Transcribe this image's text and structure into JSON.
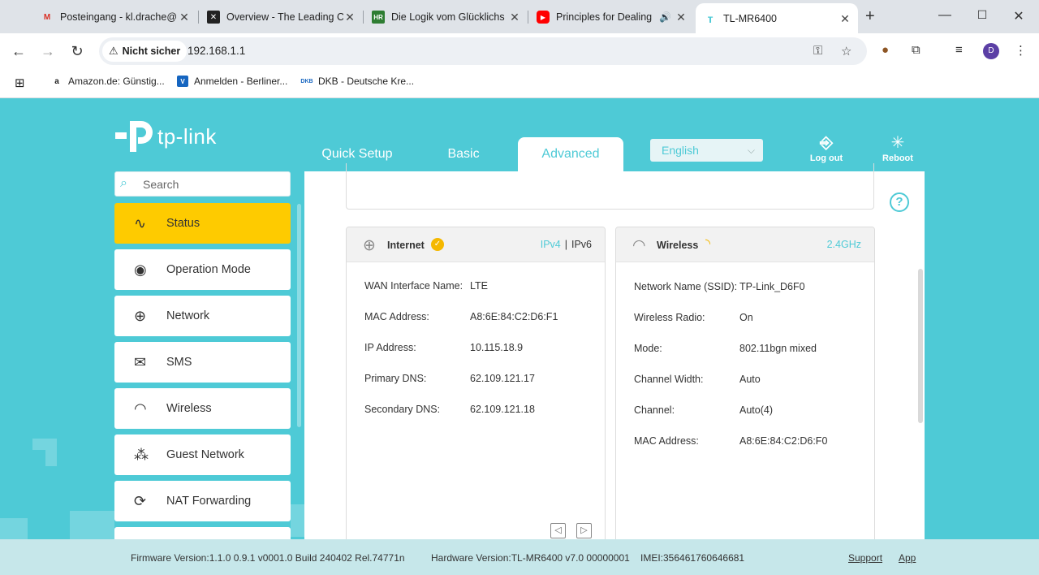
{
  "browser": {
    "tabs": [
      {
        "title": "Posteingang - kl.drache@",
        "favicon": "gmail-icon"
      },
      {
        "title": "Overview - The Leading C",
        "favicon": "app-icon"
      },
      {
        "title": "Die Logik vom Glücklichs",
        "favicon": "hr-icon"
      },
      {
        "title": "Principles for Dealing",
        "favicon": "youtube-icon"
      },
      {
        "title": "TL-MR6400",
        "favicon": "tplink-icon",
        "active": true
      }
    ],
    "security_label": "Nicht sicher",
    "url": "192.168.1.1",
    "profile_initial": "D",
    "bookmarks": [
      {
        "label": "Amazon.de: Günstig...",
        "icon": "amazon-icon"
      },
      {
        "label": "Anmelden - Berliner...",
        "icon": "bank-icon"
      },
      {
        "label": "DKB - Deutsche Kre...",
        "icon": "dkb-icon"
      }
    ]
  },
  "router": {
    "logo_text": "tp-link",
    "nav_tabs": [
      {
        "label": "Quick Setup",
        "active": false
      },
      {
        "label": "Basic",
        "active": false
      },
      {
        "label": "Advanced",
        "active": true
      }
    ],
    "language": "English",
    "logout_label": "Log out",
    "reboot_label": "Reboot",
    "search_placeholder": "Search",
    "menu": [
      {
        "label": "Status",
        "icon": "pulse-icon",
        "active": true
      },
      {
        "label": "Operation Mode",
        "icon": "toggle-icon"
      },
      {
        "label": "Network",
        "icon": "globe-icon"
      },
      {
        "label": "SMS",
        "icon": "envelope-icon"
      },
      {
        "label": "Wireless",
        "icon": "wifi-icon"
      },
      {
        "label": "Guest Network",
        "icon": "guests-icon"
      },
      {
        "label": "NAT Forwarding",
        "icon": "nat-icon"
      }
    ],
    "internet": {
      "title": "Internet",
      "ipv4": "IPv4",
      "ipv6": "IPv6",
      "rows": [
        {
          "key": "WAN Interface Name:",
          "value": "LTE"
        },
        {
          "key": "MAC Address:",
          "value": "A8:6E:84:C2:D6:F1"
        },
        {
          "key": "IP Address:",
          "value": "10.115.18.9"
        },
        {
          "key": "Primary DNS:",
          "value": "62.109.121.17"
        },
        {
          "key": "Secondary DNS:",
          "value": "62.109.121.18"
        }
      ]
    },
    "wireless": {
      "title": "Wireless",
      "band": "2.4GHz",
      "rows": [
        {
          "key": "Network Name (SSID):",
          "value": "TP-Link_D6F0"
        },
        {
          "key": "Wireless Radio:",
          "value": "On"
        },
        {
          "key": "Mode:",
          "value": "802.11bgn mixed"
        },
        {
          "key": "Channel Width:",
          "value": "Auto"
        },
        {
          "key": "Channel:",
          "value": "Auto(4)"
        },
        {
          "key": "MAC Address:",
          "value": "A8:6E:84:C2:D6:F0"
        }
      ]
    },
    "footer": {
      "firmware": "Firmware Version:1.1.0 0.9.1 v0001.0 Build 240402 Rel.74771n",
      "hardware": "Hardware Version:TL-MR6400 v7.0 00000001",
      "imei": "IMEI:356461760646681",
      "support": "Support",
      "app": "App"
    },
    "colors": {
      "accent": "#4ecad6",
      "active_menu": "#fecb00",
      "badge": "#f5b800"
    }
  }
}
